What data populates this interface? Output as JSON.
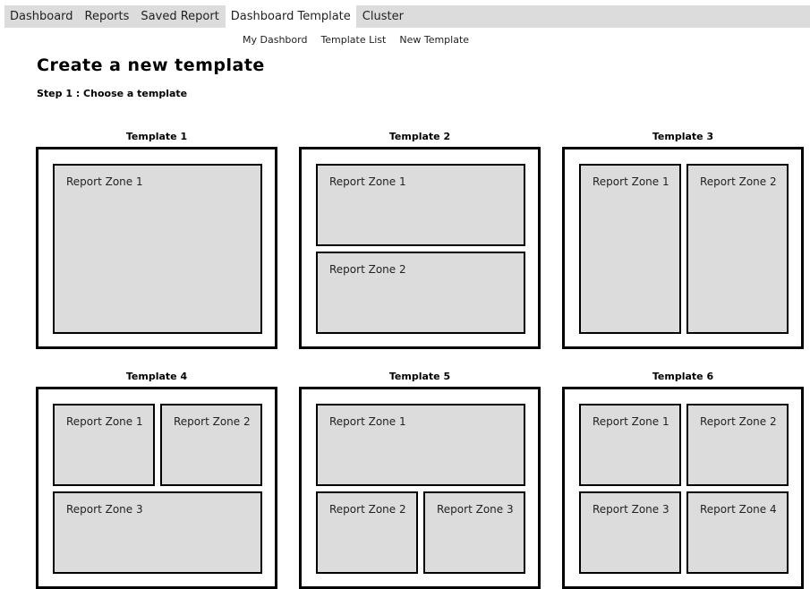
{
  "topnav": {
    "tabs": [
      {
        "label": "Dashboard",
        "active": false
      },
      {
        "label": "Reports",
        "active": false
      },
      {
        "label": "Saved Report",
        "active": false
      },
      {
        "label": "Dashboard Template",
        "active": true
      },
      {
        "label": "Cluster",
        "active": false
      }
    ]
  },
  "subnav": {
    "my_dashboard": "My Dashbord",
    "template_list": "Template List",
    "new_template": "New Template"
  },
  "page": {
    "title": "Create a new template",
    "step": "Step 1 : Choose a template"
  },
  "templates": [
    {
      "label": "Template  1",
      "zones": [
        "Report Zone  1"
      ]
    },
    {
      "label": "Template  2",
      "zones": [
        "Report Zone  1",
        "Report Zone  2"
      ]
    },
    {
      "label": "Template  3",
      "zones": [
        "Report Zone  1",
        "Report Zone  2"
      ]
    },
    {
      "label": "Template  4",
      "zones": [
        "Report Zone  1",
        "Report Zone  2",
        "Report Zone  3"
      ]
    },
    {
      "label": "Template  5",
      "zones": [
        "Report Zone  1",
        "Report Zone  2",
        "Report Zone  3"
      ]
    },
    {
      "label": "Template  6",
      "zones": [
        "Report Zone  1",
        "Report Zone  2",
        "Report Zone  3",
        "Report Zone  4"
      ]
    }
  ],
  "colors": {
    "zone_fill": "#dcdcdc",
    "nav_bg": "#dcdcdc",
    "border": "#000000"
  }
}
